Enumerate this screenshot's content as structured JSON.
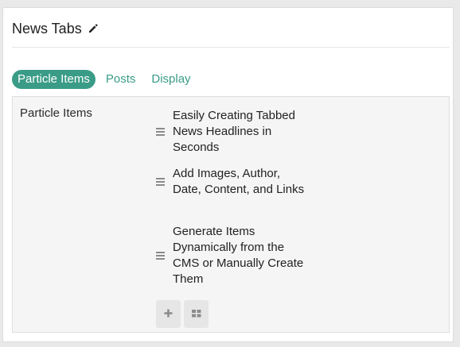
{
  "header": {
    "title": "News Tabs",
    "edit_icon": "pencil-icon"
  },
  "tabs": [
    {
      "label": "Particle Items",
      "active": true
    },
    {
      "label": "Posts",
      "active": false
    },
    {
      "label": "Display",
      "active": false
    }
  ],
  "particle_items": {
    "label": "Particle Items",
    "items": [
      {
        "title": "Easily Creating Tabbed News Headlines in Seconds"
      },
      {
        "title": "Add Images, Author, Date, Content, and Links"
      },
      {
        "title": "Generate Items Dynamically from the CMS or Manually Create Them"
      }
    ],
    "add_icon": "plus-icon",
    "grid_icon": "grid-icon"
  },
  "colors": {
    "accent": "#3a9c87",
    "content_bg": "#f5f5f5",
    "button_bg": "#e6e6e6"
  }
}
